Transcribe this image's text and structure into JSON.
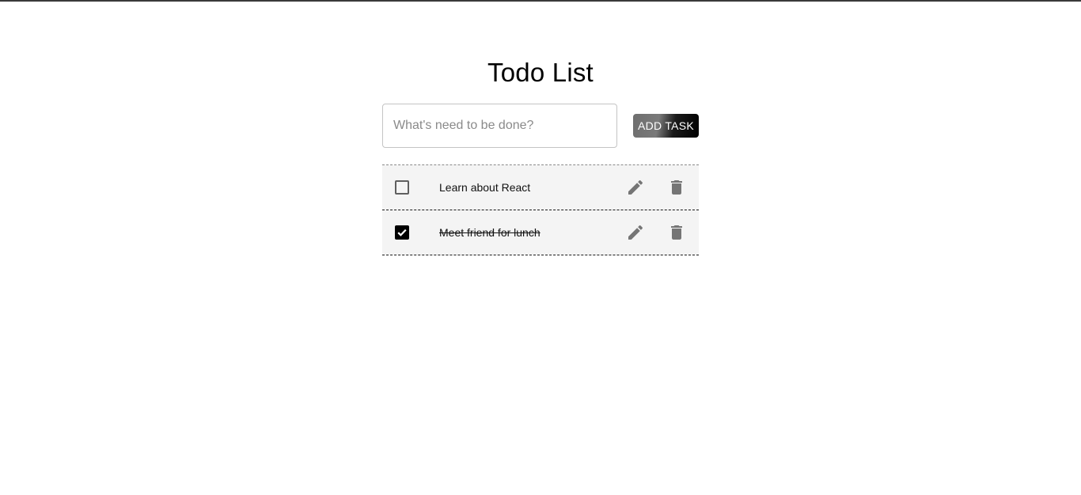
{
  "header": {
    "title": "Todo List"
  },
  "form": {
    "input_value": "",
    "input_placeholder": "What's need to be done?",
    "add_button_label": "ADD TASK"
  },
  "tasks": [
    {
      "text": "Learn about React",
      "completed": false
    },
    {
      "text": "Meet friend for lunch",
      "completed": true
    }
  ],
  "icons": {
    "edit": "pencil-icon",
    "delete": "trash-icon",
    "check": "checkmark-icon"
  },
  "colors": {
    "icon": "#757575",
    "item_background": "#f4f4f4",
    "checked_box": "#000000"
  }
}
